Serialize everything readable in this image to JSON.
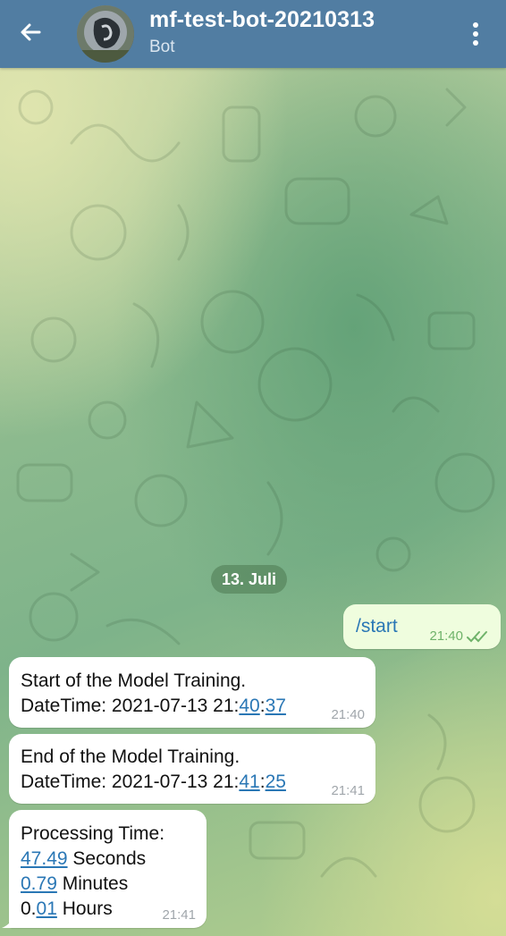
{
  "header": {
    "title": "mf-test-bot-20210313",
    "subtitle": "Bot"
  },
  "chat": {
    "date_separator": "13. Juli",
    "outgoing": {
      "command": "/start",
      "time": "21:40"
    },
    "messages": [
      {
        "line1": "Start of the Model Training.",
        "datetime_prefix": "DateTime: 2021-07-13 21:",
        "minute": "40",
        "sep": ":",
        "second": "37",
        "time": "21:40"
      },
      {
        "line1": "End of the Model Training.",
        "datetime_prefix": "DateTime: 2021-07-13 21:",
        "minute": "41",
        "sep": ":",
        "second": "25",
        "time": "21:41"
      }
    ],
    "processing": {
      "heading": "Processing Time:",
      "seconds_value": "47.49",
      "seconds_label": " Seconds",
      "minutes_value": "0.79",
      "minutes_label": " Minutes",
      "hours_prefix": "0.",
      "hours_value": "01",
      "hours_label": " Hours",
      "time": "21:41"
    }
  },
  "colors": {
    "header": "#517da2",
    "outgoing_bubble": "#effdde",
    "incoming_bubble": "#ffffff",
    "link": "#2a77b5",
    "read_check": "#6fb36a"
  },
  "icons": {
    "back": "arrow-left-icon",
    "menu": "more-vertical-icon",
    "read": "double-check-icon"
  }
}
